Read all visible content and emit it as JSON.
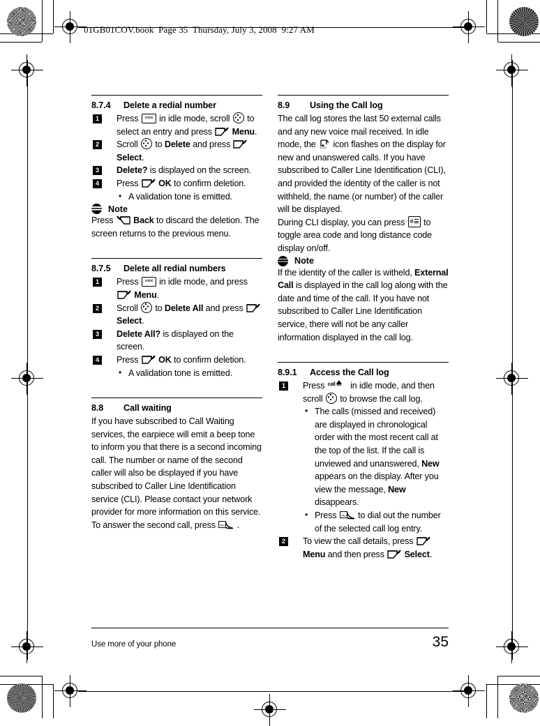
{
  "rip_header": "01GB01COV.book  Page 35  Thursday, July 3, 2008  9:27 AM",
  "footer": {
    "text": "Use more of your phone",
    "page_number": "35"
  },
  "icons": {
    "redial_key": "redial-key-icon",
    "redial_label": "redial",
    "nav_key": "navigation-scroll-icon",
    "soft_key_right": "right-soft-key-icon",
    "soft_key_left": "left-soft-key-icon",
    "talk_key": "talk-key-icon",
    "talk_label": "TALK",
    "star_key": "star-key-icon",
    "call_log_key": "call-log-display-icon",
    "call_id_key": "call-id-key-icon",
    "call_id_label": "call ID",
    "note_badge": "note-icon"
  },
  "left_column": {
    "section_874": {
      "number": "8.7.4",
      "title": "Delete a redial number",
      "steps": [
        {
          "num": "1",
          "parts": [
            {
              "t": "text",
              "v": "Press "
            },
            {
              "t": "icon",
              "v": "redial"
            },
            {
              "t": "text",
              "v": " in idle mode, scroll "
            },
            {
              "t": "icon",
              "v": "nav"
            },
            {
              "t": "text",
              "v": " to select an entry and press "
            },
            {
              "t": "icon",
              "v": "softR"
            },
            {
              "t": "bold",
              "v": "Menu"
            },
            {
              "t": "text",
              "v": "."
            }
          ]
        },
        {
          "num": "2",
          "parts": [
            {
              "t": "text",
              "v": "Scroll "
            },
            {
              "t": "icon",
              "v": "nav"
            },
            {
              "t": "text",
              "v": " to "
            },
            {
              "t": "bold",
              "v": "Delete"
            },
            {
              "t": "text",
              "v": " and press "
            },
            {
              "t": "icon",
              "v": "softR"
            },
            {
              "t": "bold",
              "v": "Select"
            },
            {
              "t": "text",
              "v": "."
            }
          ]
        },
        {
          "num": "3",
          "parts": [
            {
              "t": "bold",
              "v": "Delete?"
            },
            {
              "t": "text",
              "v": " is displayed on the screen."
            }
          ]
        },
        {
          "num": "4",
          "parts": [
            {
              "t": "text",
              "v": "Press "
            },
            {
              "t": "icon",
              "v": "softR"
            },
            {
              "t": "bold",
              "v": "OK"
            },
            {
              "t": "text",
              "v": " to confirm deletion."
            }
          ],
          "bullets": [
            "A validation tone is emitted."
          ]
        }
      ],
      "note": {
        "label": "Note",
        "parts": [
          {
            "t": "text",
            "v": "Press "
          },
          {
            "t": "icon",
            "v": "softL"
          },
          {
            "t": "bold",
            "v": "Back"
          },
          {
            "t": "text",
            "v": " to discard the deletion. The screen returns to the previous menu."
          }
        ]
      }
    },
    "section_875": {
      "number": "8.7.5",
      "title": "Delete all redial numbers",
      "steps": [
        {
          "num": "1",
          "parts": [
            {
              "t": "text",
              "v": "Press "
            },
            {
              "t": "icon",
              "v": "redial"
            },
            {
              "t": "text",
              "v": " in idle mode, and press "
            },
            {
              "t": "icon",
              "v": "softR"
            },
            {
              "t": "bold",
              "v": "Menu"
            },
            {
              "t": "text",
              "v": "."
            }
          ]
        },
        {
          "num": "2",
          "parts": [
            {
              "t": "text",
              "v": "Scroll "
            },
            {
              "t": "icon",
              "v": "nav"
            },
            {
              "t": "text",
              "v": " to "
            },
            {
              "t": "bold",
              "v": "Delete All"
            },
            {
              "t": "text",
              "v": " and press "
            },
            {
              "t": "icon",
              "v": "softR"
            },
            {
              "t": "bold",
              "v": "Select"
            },
            {
              "t": "text",
              "v": "."
            }
          ]
        },
        {
          "num": "3",
          "parts": [
            {
              "t": "bold",
              "v": "Delete All?"
            },
            {
              "t": "text",
              "v": " is displayed on the screen."
            }
          ]
        },
        {
          "num": "4",
          "parts": [
            {
              "t": "text",
              "v": "Press "
            },
            {
              "t": "icon",
              "v": "softR"
            },
            {
              "t": "bold",
              "v": "OK"
            },
            {
              "t": "text",
              "v": " to confirm deletion."
            }
          ],
          "bullets": [
            "A validation tone is emitted."
          ]
        }
      ]
    },
    "section_88": {
      "number": "8.8",
      "title": "Call waiting",
      "body_parts": [
        {
          "t": "text",
          "v": "If you have subscribed to Call Waiting services, the earpiece will emit a beep tone to inform you that there is a second incoming call. The number or name of the second caller will also be displayed if you have subscribed to Caller Line Identification service (CLI). Please contact your network provider for more information on this service."
        },
        {
          "t": "break",
          "v": ""
        },
        {
          "t": "text",
          "v": "To answer the second call, press "
        },
        {
          "t": "icon",
          "v": "talk"
        },
        {
          "t": "text",
          "v": "."
        }
      ]
    }
  },
  "right_column": {
    "section_89": {
      "number": "8.9",
      "title": "Using the Call log",
      "body_parts": [
        {
          "t": "text",
          "v": "The call log stores the last 50 external calls and any new voice mail received. In idle mode, the "
        },
        {
          "t": "icon",
          "v": "calllog"
        },
        {
          "t": "text",
          "v": " icon flashes on the display for new and unanswered calls. If you have subscribed to Caller Line Identification (CLI), and provided the identity of the caller is not withheld, the name (or number) of the caller will be displayed."
        },
        {
          "t": "break",
          "v": ""
        },
        {
          "t": "text",
          "v": "During CLI display, you can press "
        },
        {
          "t": "icon",
          "v": "star"
        },
        {
          "t": "text",
          "v": " to toggle area code and long distance code display on/off."
        }
      ],
      "note": {
        "label": "Note",
        "parts": [
          {
            "t": "text",
            "v": "If the identity of the caller is witheld, "
          },
          {
            "t": "bold",
            "v": "External Call"
          },
          {
            "t": "text",
            "v": " is displayed in the call log along with the date and time of the call. If you have not subscribed to Caller Line Identification service, there will not be any caller information displayed in the call log."
          }
        ]
      }
    },
    "section_891": {
      "number": "8.9.1",
      "title": "Access the Call log",
      "steps": [
        {
          "num": "1",
          "parts": [
            {
              "t": "text",
              "v": "Press "
            },
            {
              "t": "icon",
              "v": "callid"
            },
            {
              "t": "text",
              "v": " in idle mode, and then scroll "
            },
            {
              "t": "icon",
              "v": "nav"
            },
            {
              "t": "text",
              "v": " to browse the call log."
            }
          ],
          "rich_bullets": [
            [
              {
                "t": "text",
                "v": "The calls (missed and received) are displayed in chronological order with the most recent call at the top of the list. If the call is unviewed and unanswered, "
              },
              {
                "t": "bold",
                "v": "New"
              },
              {
                "t": "text",
                "v": " appears on the display. After you view the message, "
              },
              {
                "t": "bold",
                "v": "New"
              },
              {
                "t": "text",
                "v": " disappears."
              }
            ],
            [
              {
                "t": "text",
                "v": "Press "
              },
              {
                "t": "icon",
                "v": "talk"
              },
              {
                "t": "text",
                "v": " to dial out the number of the selected call log entry."
              }
            ]
          ]
        },
        {
          "num": "2",
          "parts": [
            {
              "t": "text",
              "v": "To view the call details, press "
            },
            {
              "t": "icon",
              "v": "softR"
            },
            {
              "t": "bold",
              "v": "Menu"
            },
            {
              "t": "text",
              "v": " and then press "
            },
            {
              "t": "icon",
              "v": "softR"
            },
            {
              "t": "bold",
              "v": "Select"
            },
            {
              "t": "text",
              "v": "."
            }
          ]
        }
      ]
    }
  }
}
